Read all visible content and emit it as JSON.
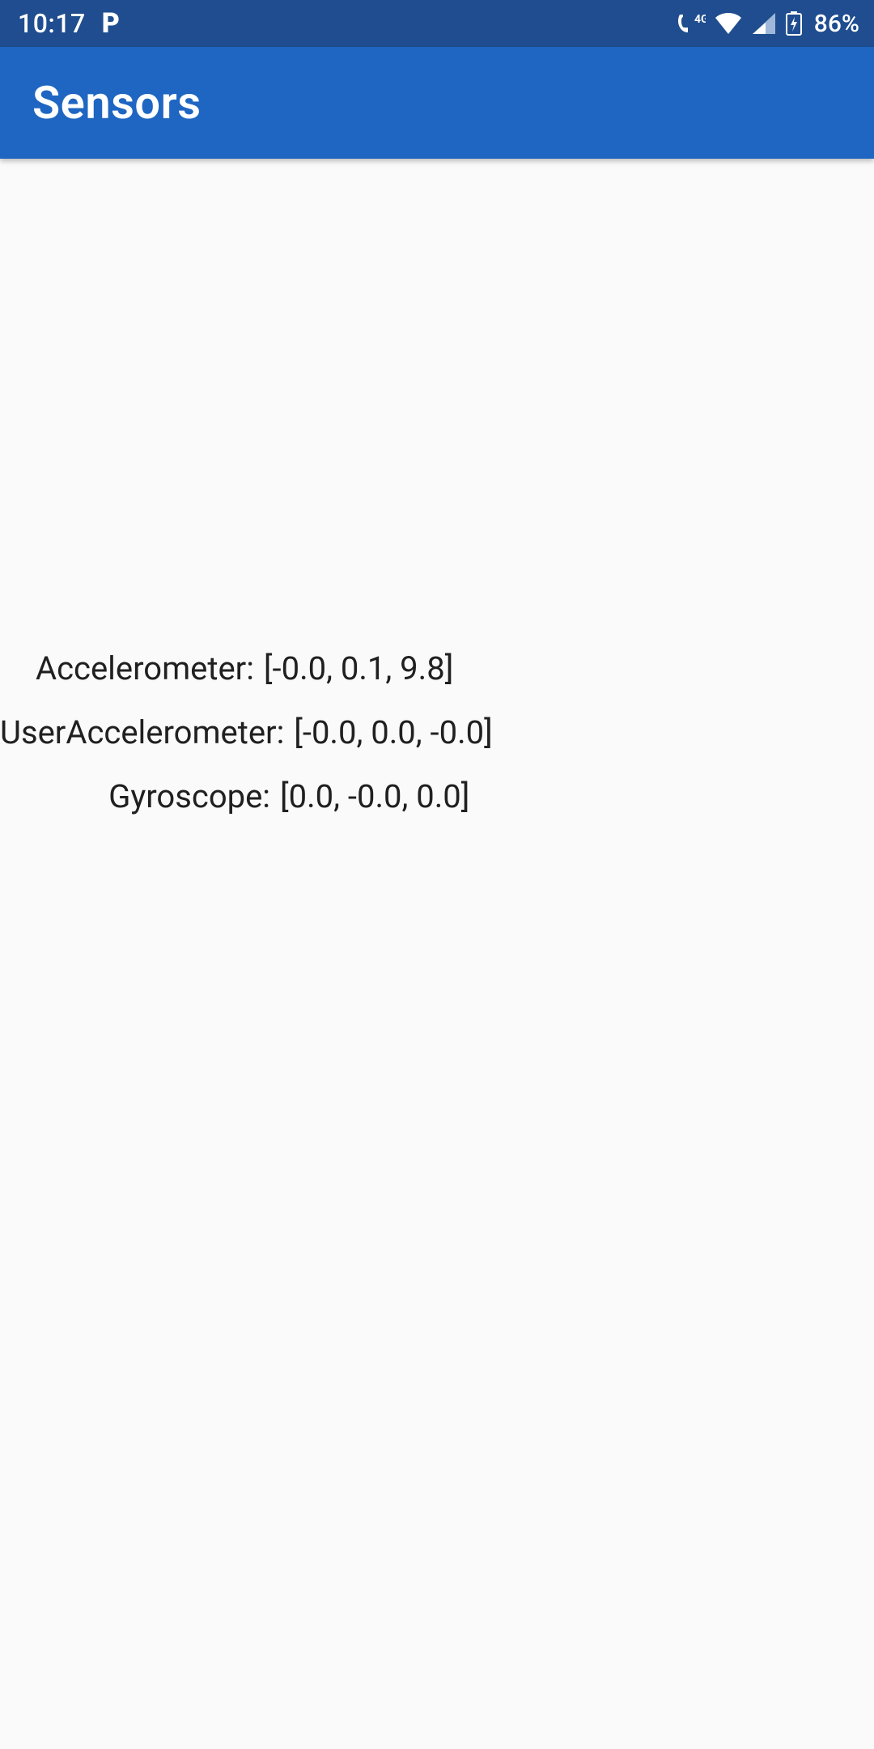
{
  "status": {
    "time": "10:17",
    "p_icon": "P",
    "network_label": "4G",
    "battery_percent": "86%"
  },
  "app_bar": {
    "title": "Sensors"
  },
  "sensors": {
    "accelerometer": {
      "label": "Accelerometer:",
      "value": "[-0.0, 0.1, 9.8]"
    },
    "user_accelerometer": {
      "label": "UserAccelerometer:",
      "value": "[-0.0, 0.0, -0.0]"
    },
    "gyroscope": {
      "label": "Gyroscope:",
      "value": "[0.0, -0.0, 0.0]"
    }
  }
}
